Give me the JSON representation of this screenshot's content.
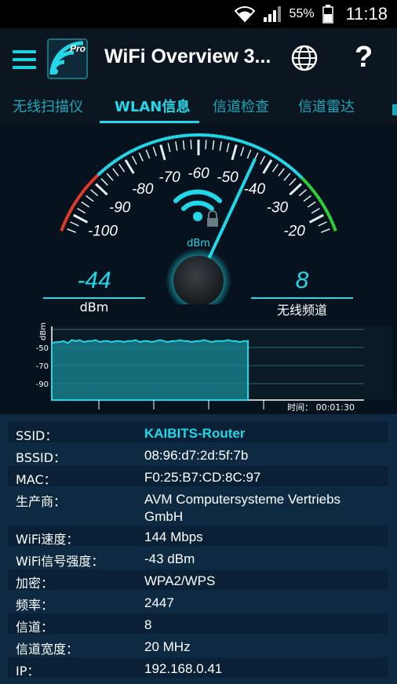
{
  "status_bar": {
    "battery_percent": "55%",
    "time": "11:18"
  },
  "app_bar": {
    "title": "WiFi Overview 3...",
    "logo_badge": "Pro",
    "help_glyph": "?"
  },
  "tabs": [
    {
      "label": "无线扫描仪",
      "active": false
    },
    {
      "label": "WLAN信息",
      "active": true
    },
    {
      "label": "信道检查",
      "active": false
    },
    {
      "label": "信道雷达",
      "active": false
    }
  ],
  "gauge": {
    "scale_labels": [
      "-100",
      "-90",
      "-80",
      "-70",
      "-60",
      "-50",
      "-40",
      "-30",
      "-20"
    ],
    "unit": "dBm",
    "needle_value": -44,
    "scale_min": -105,
    "scale_max": -15,
    "colors": {
      "weak": "#e03a2a",
      "strong": "#2fd03a",
      "accent": "#22d8e8"
    }
  },
  "readouts": {
    "signal_value": "-44",
    "signal_unit": "dBm",
    "channel_value": "8",
    "channel_label": "无线频道"
  },
  "history_chart": {
    "y_unit": "dBm",
    "y_ticks": [
      "-50",
      "-70",
      "-90"
    ],
    "time_label": "时间： 00:01:30"
  },
  "chart_data": {
    "type": "area",
    "ylabel": "dBm",
    "ylim": [
      -100,
      -30
    ],
    "y_ticks": [
      -50,
      -70,
      -90
    ],
    "values": [
      -46,
      -45,
      -45,
      -44,
      -46,
      -43,
      -44,
      -43,
      -45,
      -44,
      -44,
      -43,
      -45,
      -44,
      -44,
      -45,
      -44,
      -44,
      -45,
      -44,
      -44,
      -43,
      -45,
      -44,
      -44,
      -45,
      -44,
      -43,
      -44,
      -45,
      -44,
      -44,
      -43,
      -44,
      -44,
      -45,
      -44,
      -44,
      -43,
      -44,
      -45,
      -44,
      -44,
      -44,
      -43,
      -44,
      -44,
      -45,
      -44,
      -44
    ]
  },
  "info": [
    {
      "label": "SSID：",
      "value": "KAIBITS-Router",
      "accent": true
    },
    {
      "label": "BSSID：",
      "value": "08:96:d7:2d:5f:7b"
    },
    {
      "label": "MAC：",
      "value": "F0:25:B7:CD:8C:97"
    },
    {
      "label": "生产商：",
      "value": "AVM Computersysteme Vertriebs GmbH"
    },
    {
      "label": "WiFi速度：",
      "value": "144 Mbps"
    },
    {
      "label": "WiFi信号强度：",
      "value": "-43 dBm"
    },
    {
      "label": "加密：",
      "value": "WPA2/WPS"
    },
    {
      "label": "频率：",
      "value": "2447"
    },
    {
      "label": "信道：",
      "value": "8"
    },
    {
      "label": "信道宽度：",
      "value": "20 MHz"
    },
    {
      "label": "IP：",
      "value": "192.168.0.41"
    }
  ]
}
